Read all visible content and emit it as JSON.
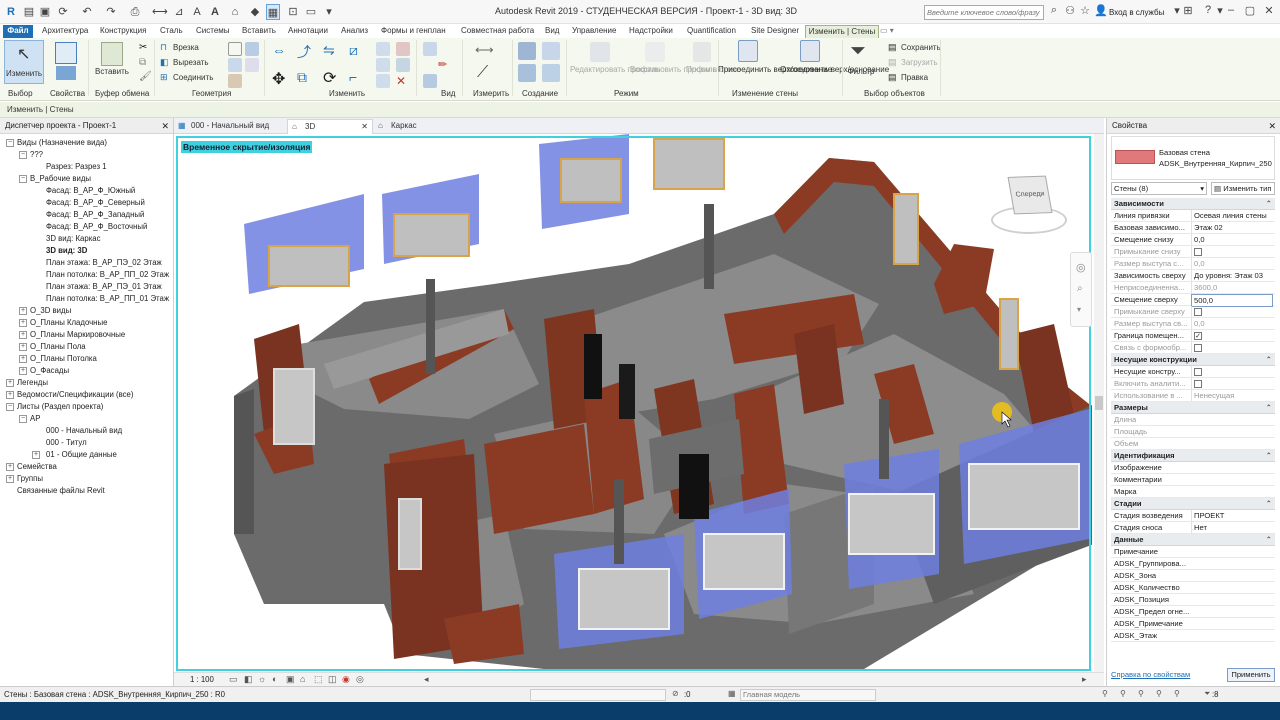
{
  "titlebar": {
    "title": "Autodesk Revit 2019 - СТУДЕНЧЕСКАЯ ВЕРСИЯ - Проект-1 - 3D вид: 3D",
    "search_placeholder": "Введите ключевое слово/фразу",
    "signin": "Вход в службы"
  },
  "menu": {
    "file": "Файл",
    "items": [
      "Архитектура",
      "Конструкция",
      "Сталь",
      "Системы",
      "Вставить",
      "Аннотации",
      "Анализ",
      "Формы и генплан",
      "Совместная работа",
      "Вид",
      "Управление",
      "Надстройки",
      "Quantification",
      "Site Designer"
    ],
    "active": "Изменить | Стены"
  },
  "ribbon": {
    "modify": "Изменить",
    "select": "Выбор",
    "properties": "Свойства",
    "paste": "Вставить",
    "clipboard": "Буфер обмена",
    "cut": "Вырезать",
    "join": "Соединить",
    "cope": "Врезка",
    "geometry": "Геометрия",
    "modify_panel": "Изменить",
    "view": "Вид",
    "measure": "Измерить",
    "create": "Создание",
    "edit_profile": "Редактировать профиль",
    "reset_profile": "Восстановить профиль",
    "wall_opening": "Проем в стене",
    "mode": "Режим",
    "attach": "Присоединить верх/основание",
    "detach": "Отсоединить верх/основание",
    "modify_walls": "Изменение стены",
    "filter": "Фильтр",
    "save": "Сохранить",
    "load": "Загрузить",
    "edit": "Правка",
    "selection": "Выбор объектов"
  },
  "context": "Изменить | Стены",
  "browser": {
    "title": "Диспетчер проекта - Проект-1",
    "nodes": [
      {
        "t": "Виды (Назначение вида)",
        "lvl": 0,
        "tg": "−"
      },
      {
        "t": "???",
        "lvl": 1,
        "tg": "−"
      },
      {
        "t": "Разрез: Разрез 1",
        "lvl": 2
      },
      {
        "t": "В_Рабочие виды",
        "lvl": 1,
        "tg": "−"
      },
      {
        "t": "Фасад: В_АР_Ф_Южный",
        "lvl": 2
      },
      {
        "t": "Фасад: В_АР_Ф_Северный",
        "lvl": 2
      },
      {
        "t": "Фасад: В_АР_Ф_Западный",
        "lvl": 2
      },
      {
        "t": "Фасад: В_АР_Ф_Восточный",
        "lvl": 2
      },
      {
        "t": "3D вид: Каркас",
        "lvl": 2
      },
      {
        "t": "3D вид: 3D",
        "lvl": 2,
        "b": true
      },
      {
        "t": "План этажа: В_АР_ПЭ_02 Этаж",
        "lvl": 2
      },
      {
        "t": "План потолка: В_АР_ПП_02 Этаж",
        "lvl": 2
      },
      {
        "t": "План этажа: В_АР_ПЭ_01 Этаж",
        "lvl": 2
      },
      {
        "t": "План потолка: В_АР_ПП_01 Этаж",
        "lvl": 2
      },
      {
        "t": "О_3D виды",
        "lvl": 1,
        "tg": "+"
      },
      {
        "t": "О_Планы Кладочные",
        "lvl": 1,
        "tg": "+"
      },
      {
        "t": "О_Планы Маркировочные",
        "lvl": 1,
        "tg": "+"
      },
      {
        "t": "О_Планы Пола",
        "lvl": 1,
        "tg": "+"
      },
      {
        "t": "О_Планы Потолка",
        "lvl": 1,
        "tg": "+"
      },
      {
        "t": "О_Фасады",
        "lvl": 1,
        "tg": "+"
      },
      {
        "t": "Легенды",
        "lvl": 0,
        "tg": "+"
      },
      {
        "t": "Ведомости/Спецификации (все)",
        "lvl": 0,
        "tg": "+"
      },
      {
        "t": "Листы (Раздел проекта)",
        "lvl": 0,
        "tg": "−"
      },
      {
        "t": "АР",
        "lvl": 1,
        "tg": "−"
      },
      {
        "t": "000 - Начальный вид",
        "lvl": 2
      },
      {
        "t": "000 - Титул",
        "lvl": 2
      },
      {
        "t": "01 - Общие данные",
        "lvl": 2,
        "tg": "+"
      },
      {
        "t": "Семейства",
        "lvl": 0,
        "tg": "+"
      },
      {
        "t": "Группы",
        "lvl": 0,
        "tg": "+"
      },
      {
        "t": "Связанные файлы Revit",
        "lvl": 0
      }
    ]
  },
  "view_tabs": [
    "000 - Начальный вид",
    "3D",
    "Каркас"
  ],
  "viewport": {
    "iso_label": "Временное скрытие/изоляция",
    "viewcube_face": "Спереди",
    "scale": "1 : 100"
  },
  "properties": {
    "title": "Свойства",
    "type_line1": "Базовая стена",
    "type_line2": "ADSK_Внутренняя_Кирпич_250",
    "selector": "Стены (8)",
    "edit_type": "Изменить тип",
    "help": "Справка по свойствам",
    "apply": "Применить",
    "rows": [
      {
        "g": "Зависимости"
      },
      {
        "n": "Линия привязки",
        "v": "Осевая линия стены"
      },
      {
        "n": "Базовая зависимо...",
        "v": "Этаж 02"
      },
      {
        "n": "Смещение снизу",
        "v": "0,0"
      },
      {
        "n": "Примыкание снизу",
        "v": "",
        "d": true,
        "c": ""
      },
      {
        "n": "Размер выступа с...",
        "v": "0,0",
        "d": true
      },
      {
        "n": "Зависимость сверху",
        "v": "До уровня: Этаж 03"
      },
      {
        "n": "Неприсоединенна...",
        "v": "3600,0",
        "d": true
      },
      {
        "n": "Смещение сверху",
        "v": "500,0"
      },
      {
        "n": "Примыкание сверху",
        "v": "",
        "d": true,
        "c": ""
      },
      {
        "n": "Размер выступа св...",
        "v": "0,0",
        "d": true
      },
      {
        "n": "Граница помещен...",
        "v": "",
        "c": "✓"
      },
      {
        "n": "Связь с формообр...",
        "v": "",
        "d": true,
        "c": ""
      },
      {
        "g": "Несущие конструкции"
      },
      {
        "n": "Несущие констру...",
        "v": "",
        "c": ""
      },
      {
        "n": "Включить аналити...",
        "v": "",
        "d": true,
        "c": ""
      },
      {
        "n": "Использование в ...",
        "v": "Ненесущая",
        "d": true
      },
      {
        "g": "Размеры"
      },
      {
        "n": "Длина",
        "v": "",
        "d": true
      },
      {
        "n": "Площадь",
        "v": "",
        "d": true
      },
      {
        "n": "Объем",
        "v": "",
        "d": true
      },
      {
        "g": "Идентификация"
      },
      {
        "n": "Изображение",
        "v": ""
      },
      {
        "n": "Комментарии",
        "v": ""
      },
      {
        "n": "Марка",
        "v": ""
      },
      {
        "g": "Стадии"
      },
      {
        "n": "Стадия возведения",
        "v": "ПРОЕКТ"
      },
      {
        "n": "Стадия сноса",
        "v": "Нет"
      },
      {
        "g": "Данные"
      },
      {
        "n": "Примечание",
        "v": ""
      },
      {
        "n": "ADSK_Группирова...",
        "v": ""
      },
      {
        "n": "ADSK_Зона",
        "v": ""
      },
      {
        "n": "ADSK_Количество",
        "v": ""
      },
      {
        "n": "ADSK_Позиция",
        "v": ""
      },
      {
        "n": "ADSK_Предел огне...",
        "v": ""
      },
      {
        "n": "ADSK_Примечание",
        "v": ""
      },
      {
        "n": "ADSK_Этаж",
        "v": ""
      }
    ]
  },
  "status": {
    "left": "Стены : Базовая стена : ADSK_Внутренняя_Кирпич_250 : R0",
    "count0": ":0",
    "model": "Главная модель",
    "filter_count": ":8"
  },
  "colors": {
    "brick": "#8b3b24",
    "glass": "#6f7fe0",
    "accent": "#3fd1e0",
    "ribbon": "#f5f8ef"
  }
}
